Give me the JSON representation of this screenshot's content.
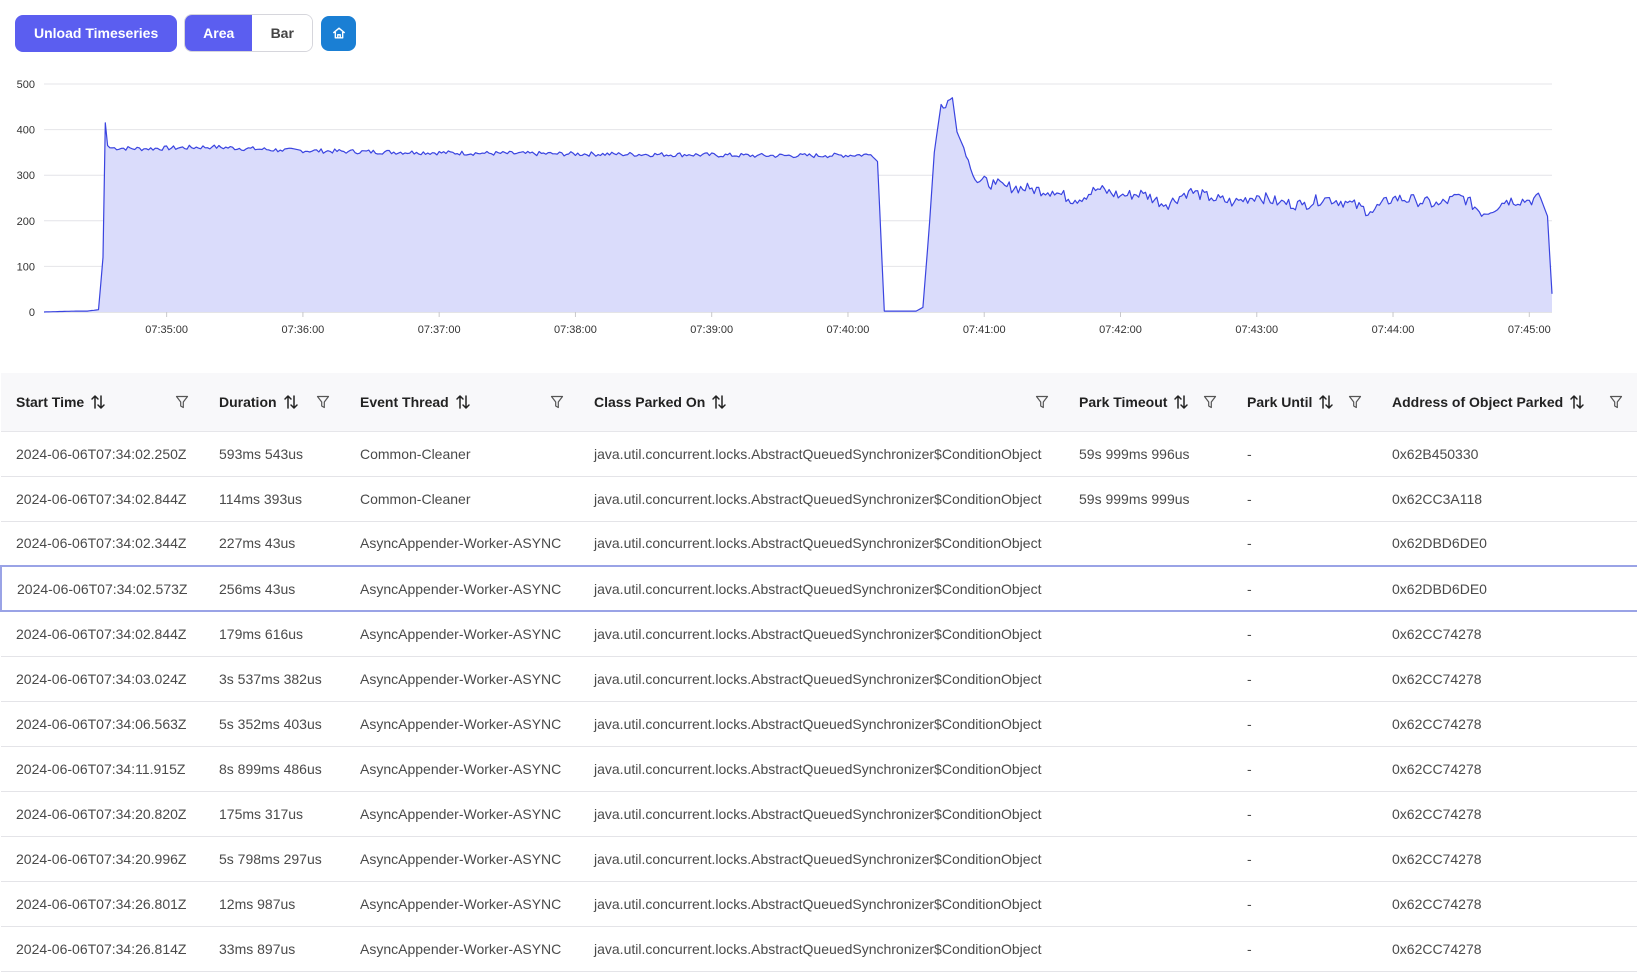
{
  "toolbar": {
    "unload_label": "Unload Timeseries",
    "view_modes": [
      {
        "label": "Area",
        "active": true
      },
      {
        "label": "Bar",
        "active": false
      }
    ],
    "home_icon": "home-icon",
    "accent_color": "#5b5ef0",
    "home_color": "#1a7fd4"
  },
  "chart_data": {
    "type": "area",
    "title": "",
    "xlabel": "",
    "ylabel": "",
    "ylim": [
      0,
      500
    ],
    "y_ticks": [
      0,
      100,
      200,
      300,
      400,
      500
    ],
    "x_ticks": [
      "07:35:00",
      "07:36:00",
      "07:37:00",
      "07:38:00",
      "07:39:00",
      "07:40:00",
      "07:41:00",
      "07:42:00",
      "07:43:00",
      "07:44:00",
      "07:45:00"
    ],
    "xlim": [
      "07:34:06",
      "07:45:10"
    ],
    "grid": true,
    "line_color": "#3a44e0",
    "fill_color": "#dadcfb",
    "series": [
      {
        "x": [
          "07:34:06",
          "07:34:20",
          "07:34:25",
          "07:34:30",
          "07:34:32",
          "07:34:33",
          "07:34:34",
          "07:34:35",
          "07:34:50",
          "07:35:20",
          "07:35:50",
          "07:36:20",
          "07:36:50",
          "07:37:20",
          "07:37:50",
          "07:38:20",
          "07:38:50",
          "07:39:20",
          "07:39:50",
          "07:40:10",
          "07:40:13",
          "07:40:16",
          "07:40:30",
          "07:40:33",
          "07:40:36",
          "07:40:38",
          "07:40:41",
          "07:40:46",
          "07:40:48",
          "07:40:51",
          "07:40:56",
          "07:41:05",
          "07:41:10",
          "07:41:20",
          "07:41:30",
          "07:41:40",
          "07:41:50",
          "07:42:00",
          "07:42:10",
          "07:42:20",
          "07:42:30",
          "07:42:40",
          "07:42:50",
          "07:43:00",
          "07:43:10",
          "07:43:20",
          "07:43:30",
          "07:43:40",
          "07:43:50",
          "07:44:00",
          "07:44:10",
          "07:44:20",
          "07:44:30",
          "07:44:40",
          "07:44:50",
          "07:45:00",
          "07:45:05",
          "07:45:08",
          "07:45:10"
        ],
        "y": [
          0,
          2,
          2,
          5,
          120,
          415,
          365,
          360,
          358,
          362,
          355,
          352,
          350,
          348,
          347,
          346,
          345,
          343,
          343,
          345,
          330,
          2,
          2,
          10,
          200,
          350,
          455,
          470,
          395,
          360,
          290,
          280,
          275,
          270,
          265,
          245,
          270,
          255,
          260,
          235,
          265,
          250,
          240,
          255,
          240,
          235,
          250,
          240,
          220,
          250,
          245,
          235,
          255,
          215,
          245,
          245,
          250,
          210,
          40
        ]
      }
    ]
  },
  "table": {
    "columns": [
      {
        "label": "Start Time"
      },
      {
        "label": "Duration"
      },
      {
        "label": "Event Thread"
      },
      {
        "label": "Class Parked On"
      },
      {
        "label": "Park Timeout"
      },
      {
        "label": "Park Until"
      },
      {
        "label": "Address of Object Parked"
      }
    ],
    "selected_row": 3,
    "rows": [
      [
        "2024-06-06T07:34:02.250Z",
        "593ms 543us",
        "Common-Cleaner",
        "java.util.concurrent.locks.AbstractQueuedSynchronizer$ConditionObject",
        "59s 999ms 996us",
        "-",
        "0x62B450330"
      ],
      [
        "2024-06-06T07:34:02.844Z",
        "114ms 393us",
        "Common-Cleaner",
        "java.util.concurrent.locks.AbstractQueuedSynchronizer$ConditionObject",
        "59s 999ms 999us",
        "-",
        "0x62CC3A118"
      ],
      [
        "2024-06-06T07:34:02.344Z",
        "227ms 43us",
        "AsyncAppender-Worker-ASYNC",
        "java.util.concurrent.locks.AbstractQueuedSynchronizer$ConditionObject",
        "",
        "-",
        "0x62DBD6DE0"
      ],
      [
        "2024-06-06T07:34:02.573Z",
        "256ms 43us",
        "AsyncAppender-Worker-ASYNC",
        "java.util.concurrent.locks.AbstractQueuedSynchronizer$ConditionObject",
        "",
        "-",
        "0x62DBD6DE0"
      ],
      [
        "2024-06-06T07:34:02.844Z",
        "179ms 616us",
        "AsyncAppender-Worker-ASYNC",
        "java.util.concurrent.locks.AbstractQueuedSynchronizer$ConditionObject",
        "",
        "-",
        "0x62CC74278"
      ],
      [
        "2024-06-06T07:34:03.024Z",
        "3s 537ms 382us",
        "AsyncAppender-Worker-ASYNC",
        "java.util.concurrent.locks.AbstractQueuedSynchronizer$ConditionObject",
        "",
        "-",
        "0x62CC74278"
      ],
      [
        "2024-06-06T07:34:06.563Z",
        "5s 352ms 403us",
        "AsyncAppender-Worker-ASYNC",
        "java.util.concurrent.locks.AbstractQueuedSynchronizer$ConditionObject",
        "",
        "-",
        "0x62CC74278"
      ],
      [
        "2024-06-06T07:34:11.915Z",
        "8s 899ms 486us",
        "AsyncAppender-Worker-ASYNC",
        "java.util.concurrent.locks.AbstractQueuedSynchronizer$ConditionObject",
        "",
        "-",
        "0x62CC74278"
      ],
      [
        "2024-06-06T07:34:20.820Z",
        "175ms 317us",
        "AsyncAppender-Worker-ASYNC",
        "java.util.concurrent.locks.AbstractQueuedSynchronizer$ConditionObject",
        "",
        "-",
        "0x62CC74278"
      ],
      [
        "2024-06-06T07:34:20.996Z",
        "5s 798ms 297us",
        "AsyncAppender-Worker-ASYNC",
        "java.util.concurrent.locks.AbstractQueuedSynchronizer$ConditionObject",
        "",
        "-",
        "0x62CC74278"
      ],
      [
        "2024-06-06T07:34:26.801Z",
        "12ms 987us",
        "AsyncAppender-Worker-ASYNC",
        "java.util.concurrent.locks.AbstractQueuedSynchronizer$ConditionObject",
        "",
        "-",
        "0x62CC74278"
      ],
      [
        "2024-06-06T07:34:26.814Z",
        "33ms 897us",
        "AsyncAppender-Worker-ASYNC",
        "java.util.concurrent.locks.AbstractQueuedSynchronizer$ConditionObject",
        "",
        "-",
        "0x62CC74278"
      ]
    ]
  }
}
